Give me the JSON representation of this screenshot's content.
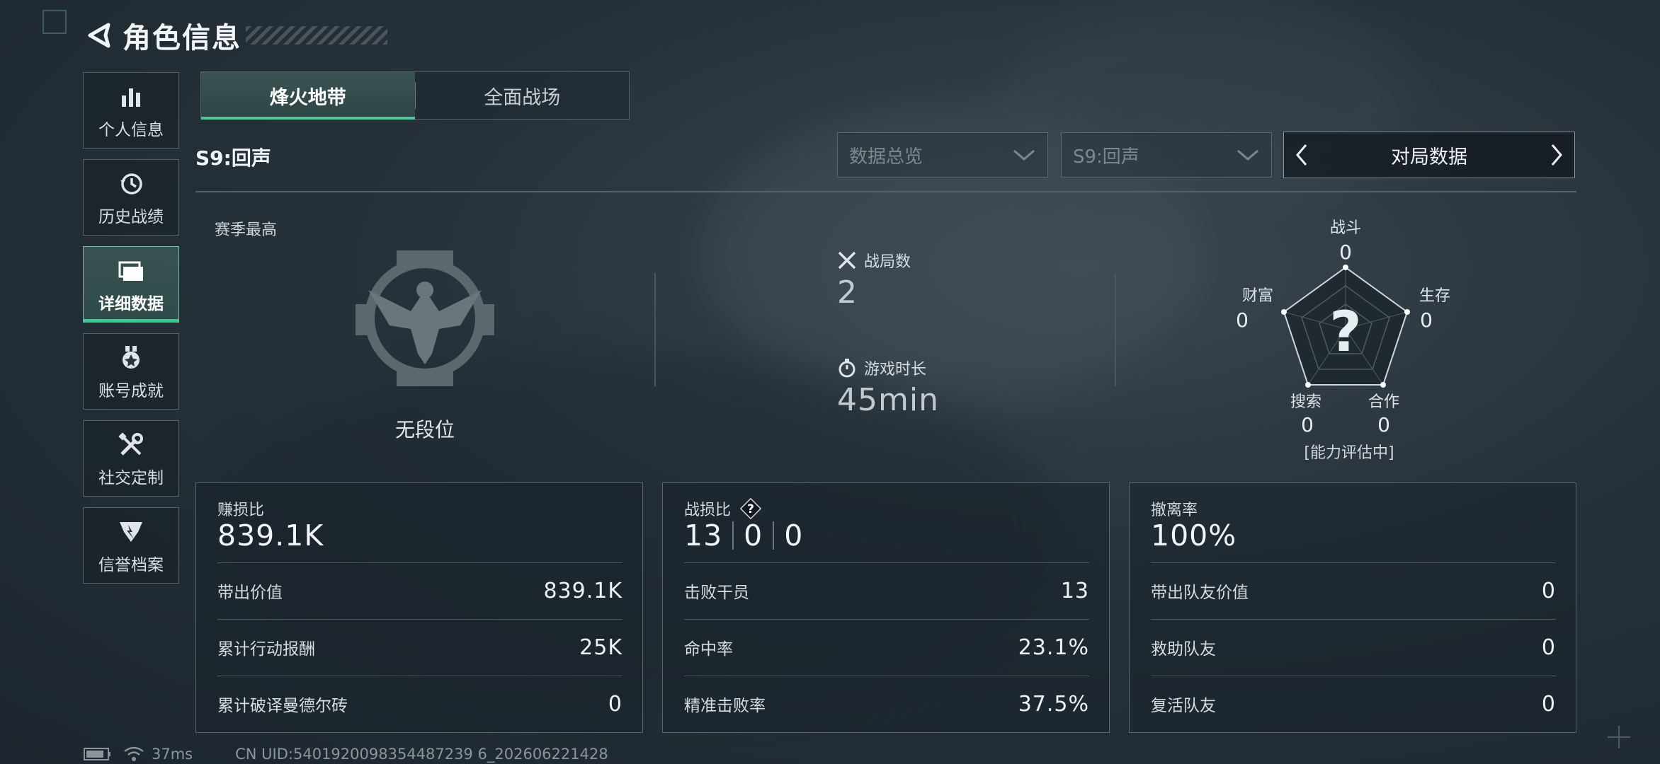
{
  "header": {
    "title": "角色信息"
  },
  "sidebar": {
    "items": [
      {
        "label": "个人信息",
        "icon": "bar-chart-icon"
      },
      {
        "label": "历史战绩",
        "icon": "history-clock-icon"
      },
      {
        "label": "详细数据",
        "icon": "folder-icon",
        "active": true
      },
      {
        "label": "账号成就",
        "icon": "medal-icon"
      },
      {
        "label": "社交定制",
        "icon": "tools-icon"
      },
      {
        "label": "信誉档案",
        "icon": "shield-emblem-icon"
      }
    ]
  },
  "mode_tabs": [
    {
      "label": "烽火地带",
      "active": true
    },
    {
      "label": "全面战场",
      "active": false
    }
  ],
  "filters": {
    "season_label": "S9:回声",
    "dropdown_overview": "数据总览",
    "dropdown_season": "S9:回声",
    "pager_label": "对局数据"
  },
  "summary": {
    "season_best_label": "赛季最高",
    "rank_text": "无段位",
    "matches_label": "战局数",
    "matches_value": "2",
    "playtime_label": "游戏时长",
    "playtime_value": "45min"
  },
  "radar": {
    "combat_label": "战斗",
    "combat_value": "0",
    "survival_label": "生存",
    "survival_value": "0",
    "coop_label": "合作",
    "coop_value": "0",
    "search_label": "搜索",
    "search_value": "0",
    "wealth_label": "财富",
    "wealth_value": "0",
    "center_mark": "?",
    "note": "[能力评估中]"
  },
  "cards": {
    "profit": {
      "title": "赚损比",
      "big": "839.1K",
      "rows": [
        {
          "k": "带出价值",
          "v": "839.1K"
        },
        {
          "k": "累计行动报酬",
          "v": "25K"
        },
        {
          "k": "累计破译曼德尔砖",
          "v": "0"
        }
      ]
    },
    "combat": {
      "title": "战损比",
      "help": "?",
      "kd": [
        "13",
        "0",
        "0"
      ],
      "rows": [
        {
          "k": "击败干员",
          "v": "13"
        },
        {
          "k": "命中率",
          "v": "23.1%"
        },
        {
          "k": "精准击败率",
          "v": "37.5%"
        }
      ]
    },
    "extract": {
      "title": "撤离率",
      "big": "100%",
      "rows": [
        {
          "k": "带出队友价值",
          "v": "0"
        },
        {
          "k": "救助队友",
          "v": "0"
        },
        {
          "k": "复活队友",
          "v": "0"
        }
      ]
    }
  },
  "footer": {
    "ping": "37ms",
    "uid": "CN UID:5401920098354487239 6_202606221428"
  },
  "colors": {
    "accent": "#2fd18a",
    "panel_border": "#5b6770"
  }
}
